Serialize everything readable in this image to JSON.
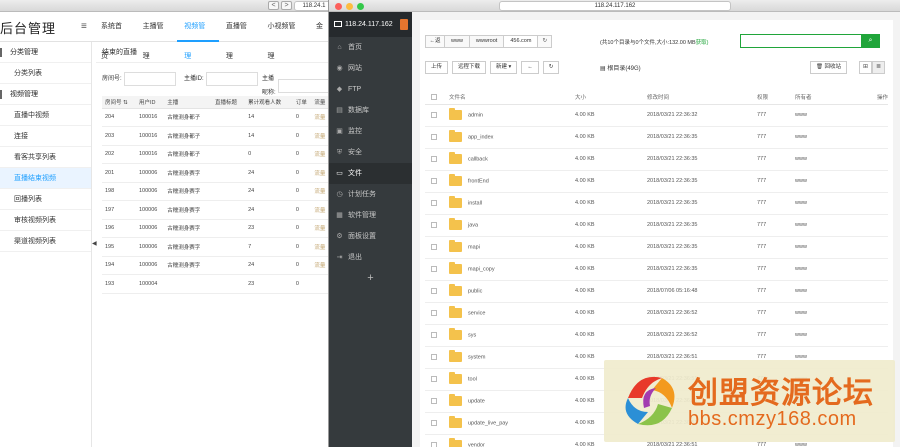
{
  "left_browser": {
    "url": "118.24.1",
    "nav_back": "<",
    "nav_fwd": ">"
  },
  "left_app": {
    "logo": "后台管理",
    "menu_icon": "≡",
    "top_nav": [
      "系统首页",
      "主播管理",
      "视频管理",
      "直播管理",
      "小视频管理",
      "金"
    ],
    "sidebar": [
      {
        "label": "分类管理",
        "group": true
      },
      {
        "label": "分类列表",
        "group": false
      },
      {
        "label": "视频管理",
        "group": true
      },
      {
        "label": "直播中视频",
        "group": false
      },
      {
        "label": "连接",
        "group": false
      },
      {
        "label": "看客共享列表",
        "group": false
      },
      {
        "label": "直播结束视频",
        "group": false,
        "active": true
      },
      {
        "label": "回播列表",
        "group": false
      },
      {
        "label": "审核视频列表",
        "group": false
      },
      {
        "label": "渠道视频列表",
        "group": false
      }
    ],
    "breadcrumb": "结束的直播",
    "filters": [
      {
        "label": "房间号:",
        "placeholder": ""
      },
      {
        "label": "主播ID:",
        "placeholder": ""
      },
      {
        "label": "主播昵称:",
        "placeholder": ""
      }
    ],
    "table": {
      "headers": [
        "房间号 ⇅",
        "用户ID",
        "主播",
        "直播标题",
        "累计观看人数",
        "订单",
        "流量"
      ],
      "rows": [
        [
          "204",
          "100016",
          "古糯测身都子",
          "",
          "14",
          "0",
          "流量"
        ],
        [
          "203",
          "100016",
          "古糯测身都子",
          "",
          "14",
          "0",
          "流量"
        ],
        [
          "202",
          "100016",
          "古糯测身都子",
          "",
          "0",
          "0",
          "流量"
        ],
        [
          "201",
          "100006",
          "古糯测身赛字",
          "",
          "24",
          "0",
          "流量"
        ],
        [
          "198",
          "100006",
          "古糯测身赛字",
          "",
          "24",
          "0",
          "流量"
        ],
        [
          "197",
          "100006",
          "古糯测身赛字",
          "",
          "24",
          "0",
          "流量"
        ],
        [
          "196",
          "100006",
          "古糯测身赛字",
          "",
          "23",
          "0",
          "流量"
        ],
        [
          "195",
          "100006",
          "古糯测身赛字",
          "",
          "7",
          "0",
          "流量"
        ],
        [
          "194",
          "100006",
          "古糯测身赛字",
          "",
          "24",
          "0",
          "流量"
        ],
        [
          "193",
          "100004",
          "",
          "",
          "23",
          "0",
          ""
        ]
      ]
    },
    "sidebar_toggle": "◀"
  },
  "right_browser": {
    "url": "118.24.117.162"
  },
  "bt_panel": {
    "host": "118.24.117.162",
    "nav": [
      {
        "label": "首页",
        "icon": "⌂"
      },
      {
        "label": "网站",
        "icon": "◉"
      },
      {
        "label": "FTP",
        "icon": "◆"
      },
      {
        "label": "数据库",
        "icon": "▤"
      },
      {
        "label": "监控",
        "icon": "▣"
      },
      {
        "label": "安全",
        "icon": "⛨"
      },
      {
        "label": "文件",
        "icon": "▭",
        "active": true
      },
      {
        "label": "计划任务",
        "icon": "◷"
      },
      {
        "label": "软件管理",
        "icon": "▦"
      },
      {
        "label": "面板设置",
        "icon": "⚙"
      },
      {
        "label": "退出",
        "icon": "⇥"
      }
    ],
    "nav_add": "+",
    "path": {
      "back": "←返",
      "segments": [
        "www",
        "wwwroot",
        "456.com"
      ],
      "refresh": "↻"
    },
    "info": "(共10个目录与0个文件,大小:132.00 MB",
    "info_action": "获取)",
    "search_placeholder": "",
    "search_icon": "🔍",
    "toolbar": [
      "上传",
      "远程下载",
      "新建 ▾",
      "←",
      "↻"
    ],
    "root_label": "根目录(49G)",
    "recycle": "回收站",
    "table_headers": [
      "",
      "文件名",
      "大小",
      "修改时间",
      "权限",
      "所有者",
      "操作"
    ],
    "files": [
      {
        "name": "admin",
        "size": "4.00 KB",
        "mtime": "2018/03/21 22:36:32",
        "perm": "777",
        "owner": "www"
      },
      {
        "name": "app_index",
        "size": "4.00 KB",
        "mtime": "2018/03/21 22:36:35",
        "perm": "777",
        "owner": "www"
      },
      {
        "name": "callback",
        "size": "4.00 KB",
        "mtime": "2018/03/21 22:36:35",
        "perm": "777",
        "owner": "www"
      },
      {
        "name": "frontEnd",
        "size": "4.00 KB",
        "mtime": "2018/03/21 22:36:35",
        "perm": "777",
        "owner": "www"
      },
      {
        "name": "install",
        "size": "4.00 KB",
        "mtime": "2018/03/21 22:36:35",
        "perm": "777",
        "owner": "www"
      },
      {
        "name": "java",
        "size": "4.00 KB",
        "mtime": "2018/03/21 22:36:35",
        "perm": "777",
        "owner": "www"
      },
      {
        "name": "mapi",
        "size": "4.00 KB",
        "mtime": "2018/03/21 22:36:35",
        "perm": "777",
        "owner": "www"
      },
      {
        "name": "mapi_copy",
        "size": "4.00 KB",
        "mtime": "2018/03/21 22:36:35",
        "perm": "777",
        "owner": "www"
      },
      {
        "name": "public",
        "size": "4.00 KB",
        "mtime": "2018/07/06 05:16:48",
        "perm": "777",
        "owner": "www"
      },
      {
        "name": "service",
        "size": "4.00 KB",
        "mtime": "2018/03/21 22:36:52",
        "perm": "777",
        "owner": "www"
      },
      {
        "name": "sys",
        "size": "4.00 KB",
        "mtime": "2018/03/21 22:36:52",
        "perm": "777",
        "owner": "www"
      },
      {
        "name": "system",
        "size": "4.00 KB",
        "mtime": "2018/03/21 22:36:51",
        "perm": "777",
        "owner": "www"
      },
      {
        "name": "tool",
        "size": "4.00 KB",
        "mtime": "2018/03/21 22:36:51",
        "perm": "777",
        "owner": "www"
      },
      {
        "name": "update",
        "size": "4.00 KB",
        "mtime": "2018/03/21 22:36:51",
        "perm": "777",
        "owner": "www"
      },
      {
        "name": "update_live_pay",
        "size": "4.00 KB",
        "mtime": "2018/03/21 22:36:51",
        "perm": "777",
        "owner": "www"
      },
      {
        "name": "vendor",
        "size": "4.00 KB",
        "mtime": "2018/03/21 22:36:51",
        "perm": "777",
        "owner": "www"
      }
    ]
  },
  "watermark": {
    "title": "创盟资源论坛",
    "url": "bbs.cmzy168.com"
  },
  "colors": {
    "bt_green": "#20a53a",
    "bt_sidebar": "#353a3d",
    "left_accent": "#1e9fff",
    "folder": "#f4c24c",
    "watermark": "#e46a1e"
  }
}
